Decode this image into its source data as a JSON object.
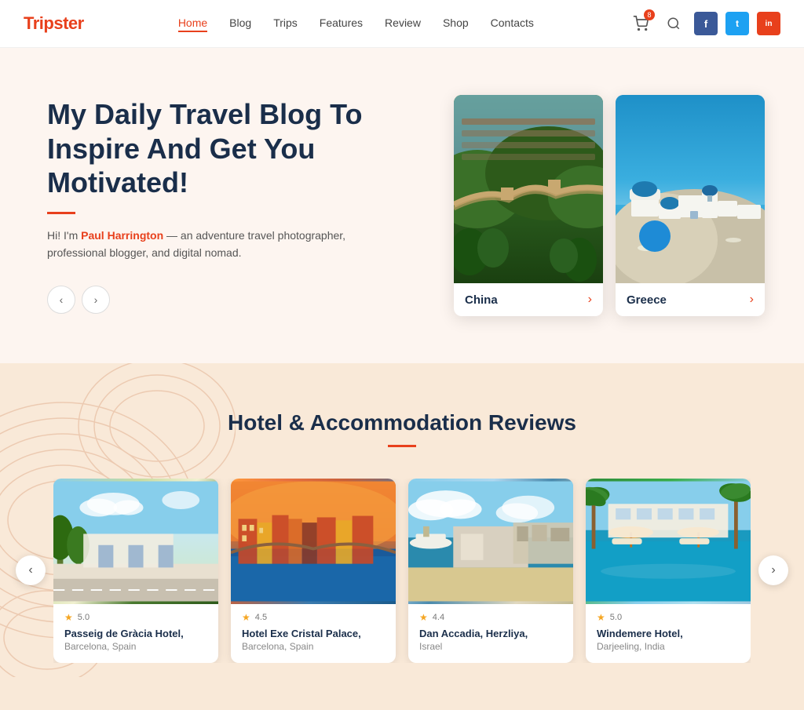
{
  "brand": {
    "name_prefix": "Trip",
    "name_highlight": "s",
    "name_suffix": "ter"
  },
  "navbar": {
    "cart_badge": "8",
    "links": [
      {
        "label": "Home",
        "active": true
      },
      {
        "label": "Blog",
        "active": false
      },
      {
        "label": "Trips",
        "active": false
      },
      {
        "label": "Features",
        "active": false
      },
      {
        "label": "Review",
        "active": false
      },
      {
        "label": "Shop",
        "active": false
      },
      {
        "label": "Contacts",
        "active": false
      }
    ],
    "social": [
      {
        "label": "f",
        "class": "social-fb"
      },
      {
        "label": "t",
        "class": "social-tw"
      },
      {
        "label": "in",
        "class": "social-ig"
      }
    ]
  },
  "hero": {
    "title": "My Daily Travel Blog To Inspire And Get You Motivated!",
    "author_name": "Paul Harrington",
    "description_prefix": "Hi! I'm ",
    "description_suffix": " — an adventure travel photographer, professional blogger, and digital nomad.",
    "prev_label": "‹",
    "next_label": "›",
    "destinations": [
      {
        "name": "China",
        "arrow": "›"
      },
      {
        "name": "Greece",
        "arrow": "›"
      }
    ]
  },
  "reviews": {
    "title": "Hotel & Accommodation Reviews",
    "prev_label": "‹",
    "next_label": "›",
    "hotels": [
      {
        "name": "Passeig de Gràcia Hotel,",
        "location": "Barcelona, Spain",
        "rating": "5.0",
        "stars": 5
      },
      {
        "name": "Hotel Exe Cristal Palace,",
        "location": "Barcelona, Spain",
        "rating": "4.5",
        "stars": 4
      },
      {
        "name": "Dan Accadia, Herzliya,",
        "location": "Israel",
        "rating": "4.4",
        "stars": 4
      },
      {
        "name": "Windemere Hotel,",
        "location": "Darjeeling, India",
        "rating": "5.0",
        "stars": 5
      }
    ]
  }
}
